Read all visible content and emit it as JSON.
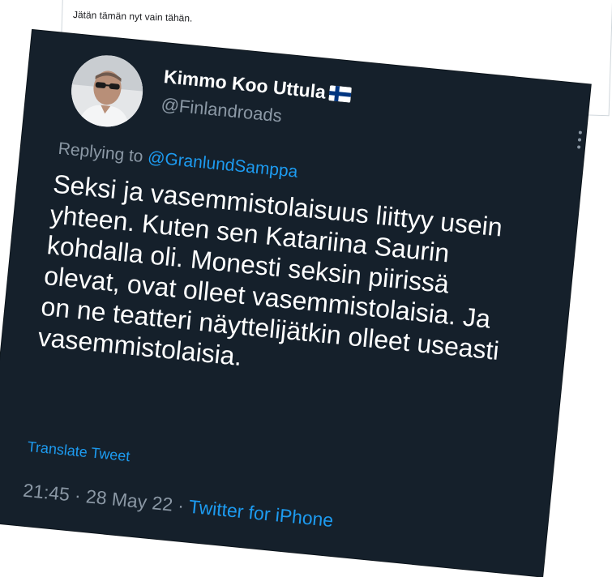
{
  "post": {
    "caption": "Jätän tämän nyt vain tähän."
  },
  "tweet": {
    "display_name": "Kimmo Koo Uttula",
    "flag_icon": "finland-flag-icon",
    "handle": "@Finlandroads",
    "replying_prefix": "Replying to",
    "replying_to": "@GranlundSamppa",
    "text": "Seksi ja vasemmistolaisuus liittyy usein yhteen. Kuten sen Katariina Saurin kohdalla oli. Monesti seksin piirissä olevat, ovat olleet vasemmistolaisia. Ja on ne teatteri näyttelijätkin olleet useasti vasemmistolaisia.",
    "translate_label": "Translate Tweet",
    "time": "21:45",
    "separator": "·",
    "date": "28 May 22",
    "source": "Twitter for iPhone",
    "more_icon": "more-vertical-icon"
  },
  "colors": {
    "card_bg": "#15202b",
    "secondary_text": "#8b98a5",
    "link": "#1d9bf0",
    "flag_blue": "#003580"
  }
}
